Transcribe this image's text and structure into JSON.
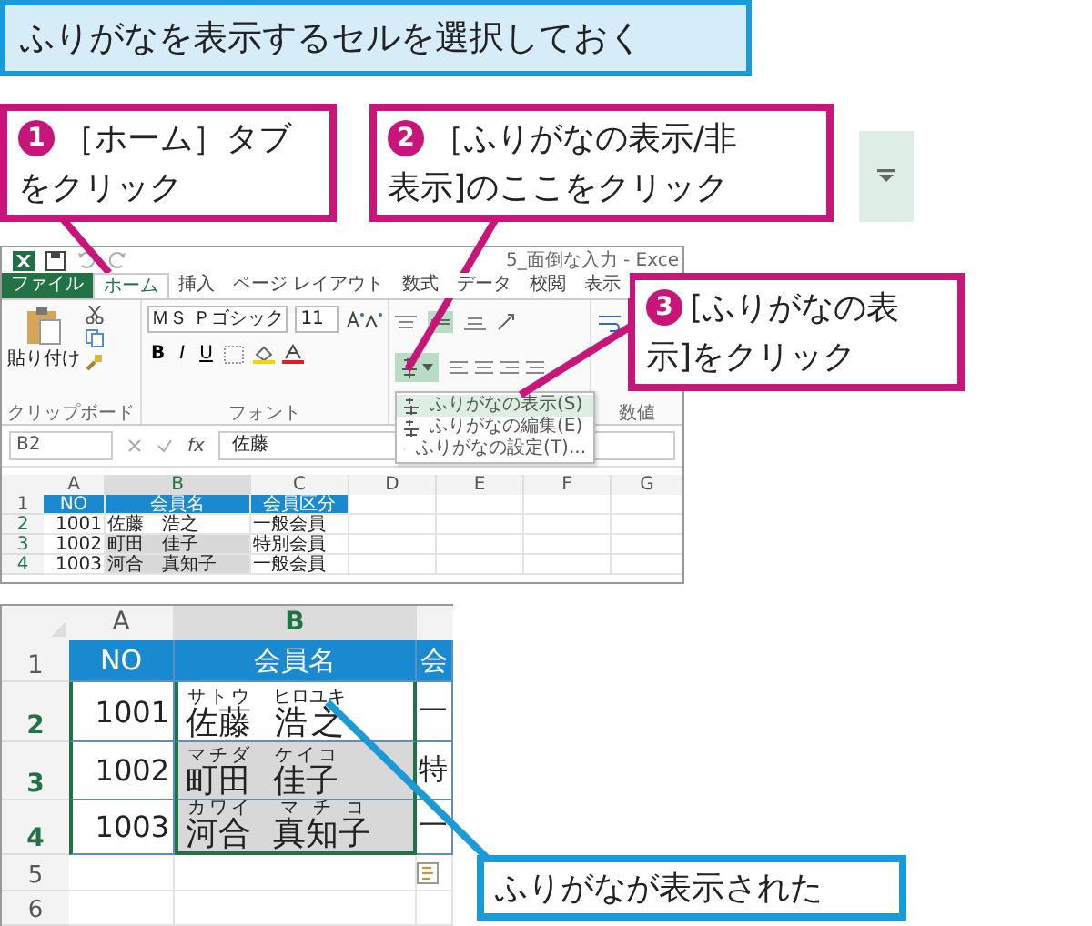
{
  "instruction": "ふりがなを表示するセルを選択しておく",
  "callouts": [
    {
      "number": "1",
      "lines": [
        "［ホーム］タブ",
        "をクリック"
      ],
      "color": "#c8157a"
    },
    {
      "number": "2",
      "lines": [
        "［ふりがなの表示/非",
        "表示]のここをクリック"
      ],
      "color": "#c8157a"
    },
    {
      "number": "3",
      "lines": [
        "[ふりがなの表",
        "示]をクリック"
      ],
      "color": "#c8157a"
    },
    {
      "lines": [
        "ふりがなが表示された"
      ],
      "color": "#1a9ad6"
    }
  ],
  "excel_top": {
    "title": "5_面倒な入力 - Exce",
    "tabs": [
      {
        "label": "ファイル",
        "kind": "file",
        "selected": false
      },
      {
        "label": "ホーム",
        "kind": "tab",
        "selected": true
      },
      {
        "label": "挿入",
        "kind": "tab",
        "selected": false
      },
      {
        "label": "ページ レイアウト",
        "kind": "tab",
        "selected": false
      },
      {
        "label": "数式",
        "kind": "tab",
        "selected": false
      },
      {
        "label": "データ",
        "kind": "tab",
        "selected": false
      },
      {
        "label": "校閲",
        "kind": "tab",
        "selected": false
      },
      {
        "label": "表示",
        "kind": "tab",
        "selected": false
      }
    ],
    "paste_label": "貼り付け",
    "font_name": "ＭＳ Ｐゴシック",
    "font_size": "11",
    "format_buttons": [
      "B",
      "I",
      "U"
    ],
    "groups": [
      "クリップボード",
      "フォント",
      "数値"
    ],
    "phonetic_menu": [
      {
        "label": "ふりがなの表示(S)",
        "selected": true
      },
      {
        "label": "ふりがなの編集(E)",
        "selected": false
      },
      {
        "label": "ふりがなの設定(T)...",
        "selected": false
      }
    ],
    "name_box": "B2",
    "function_label": "fx",
    "formula": "佐藤",
    "columns": [
      "A",
      "B",
      "C",
      "D",
      "E",
      "F",
      "G"
    ],
    "rows": [
      {
        "row": "1",
        "cells": [
          "NO",
          "会員名",
          "会員区分"
        ]
      },
      {
        "row": "2",
        "cells": [
          "1001",
          "佐藤　浩之",
          "一般会員"
        ]
      },
      {
        "row": "3",
        "cells": [
          "1002",
          "町田　佳子",
          "特別会員"
        ]
      },
      {
        "row": "4",
        "cells": [
          "1003",
          "河合　真知子",
          "一般会員"
        ]
      }
    ]
  },
  "excel_bottom": {
    "columns": [
      "A",
      "B"
    ],
    "header": {
      "row": "1",
      "cells": [
        "NO",
        "会員名",
        "会"
      ]
    },
    "rows": [
      {
        "row": "2",
        "no": "1001",
        "parts": [
          {
            "text": "佐藤",
            "reading": "サトウ"
          },
          {
            "text": "浩之",
            "reading": "ヒロユキ"
          }
        ],
        "column_3": "一"
      },
      {
        "row": "3",
        "no": "1002",
        "parts": [
          {
            "text": "町田",
            "reading": "マチダ"
          },
          {
            "text": "佳子",
            "reading": "ケイコ"
          }
        ],
        "column_3": "特"
      },
      {
        "row": "4",
        "no": "1003",
        "parts": [
          {
            "text": "河合",
            "reading": "カワイ"
          },
          {
            "text": "真知子",
            "reading": "マチコ"
          }
        ],
        "column_3": "一"
      }
    ],
    "empty_rows": [
      "5",
      "6"
    ]
  }
}
